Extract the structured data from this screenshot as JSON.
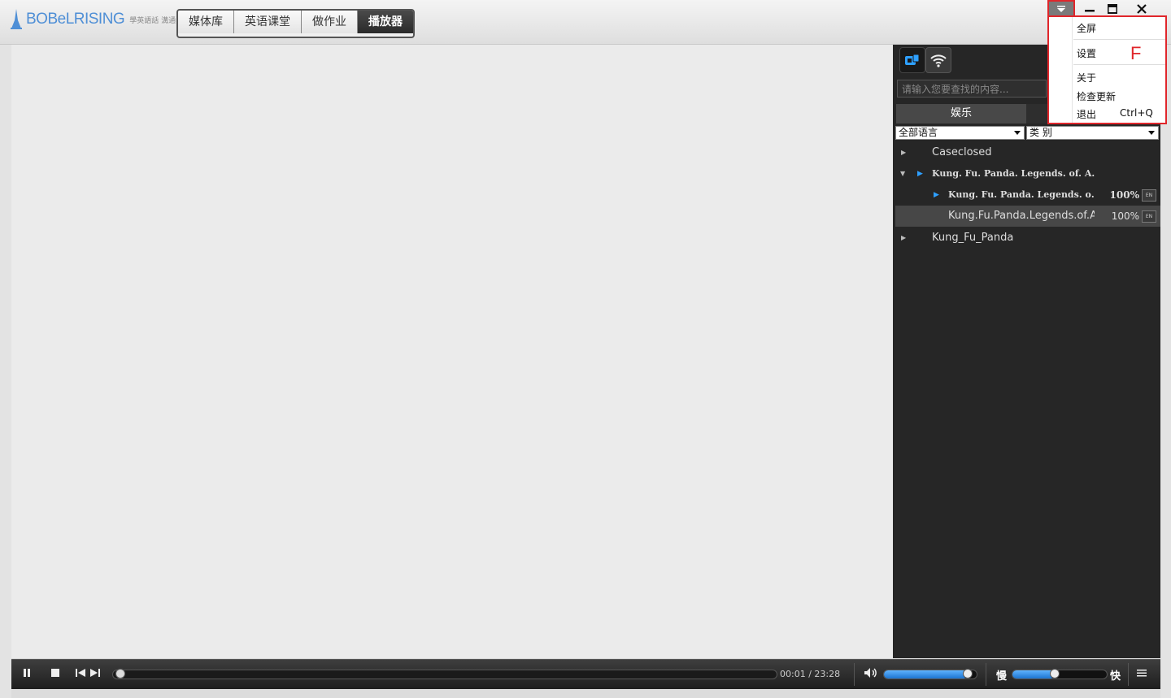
{
  "app": {
    "logo_text": "BOBeLRISING",
    "logo_sub": "學英語話 溝通!"
  },
  "nav_tabs": [
    {
      "label": "媒体库",
      "active": false
    },
    {
      "label": "英语课堂",
      "active": false
    },
    {
      "label": "做作业",
      "active": false
    },
    {
      "label": "播放器",
      "active": true
    }
  ],
  "panel": {
    "search_placeholder": "请输入您要查找的内容...",
    "category_tabs": [
      "娱乐",
      ""
    ],
    "language_select": "全部语言",
    "category_select": "类 别",
    "tree": [
      {
        "name": "Caseclosed",
        "level": 0,
        "expanded": false
      },
      {
        "name": "Kung. Fu. Panda. Legends. of. A…",
        "level": 0,
        "expanded": true,
        "playing": true
      },
      {
        "name": "Kung. Fu. Panda. Legends. o…",
        "level": 1,
        "playing": true,
        "percent": "100%",
        "lang": "EN"
      },
      {
        "name": "Kung.Fu.Panda.Legends.of.A...",
        "level": 1,
        "selected": true,
        "percent": "100%",
        "lang": "EN"
      },
      {
        "name": "Kung_Fu_Panda",
        "level": 0,
        "expanded": false
      }
    ]
  },
  "player": {
    "current_time": "00:01",
    "separator": "/",
    "total_time": "23:28",
    "progress": 0.0007,
    "volume": 0.9,
    "speed": 0.45,
    "slow_label": "慢",
    "fast_label": "快"
  },
  "menu": {
    "items": [
      {
        "label": "全屏",
        "shortcut": ""
      },
      {
        "label": "设置",
        "shortcut": ""
      },
      {
        "label": "关于",
        "shortcut": ""
      },
      {
        "label": "检查更新",
        "shortcut": ""
      },
      {
        "label": "退出",
        "shortcut": "Ctrl+Q"
      }
    ],
    "annotation": "F"
  },
  "colors": {
    "accent": "#2ea0ff",
    "highlight": "#e0262b",
    "panel_bg": "#262626"
  }
}
